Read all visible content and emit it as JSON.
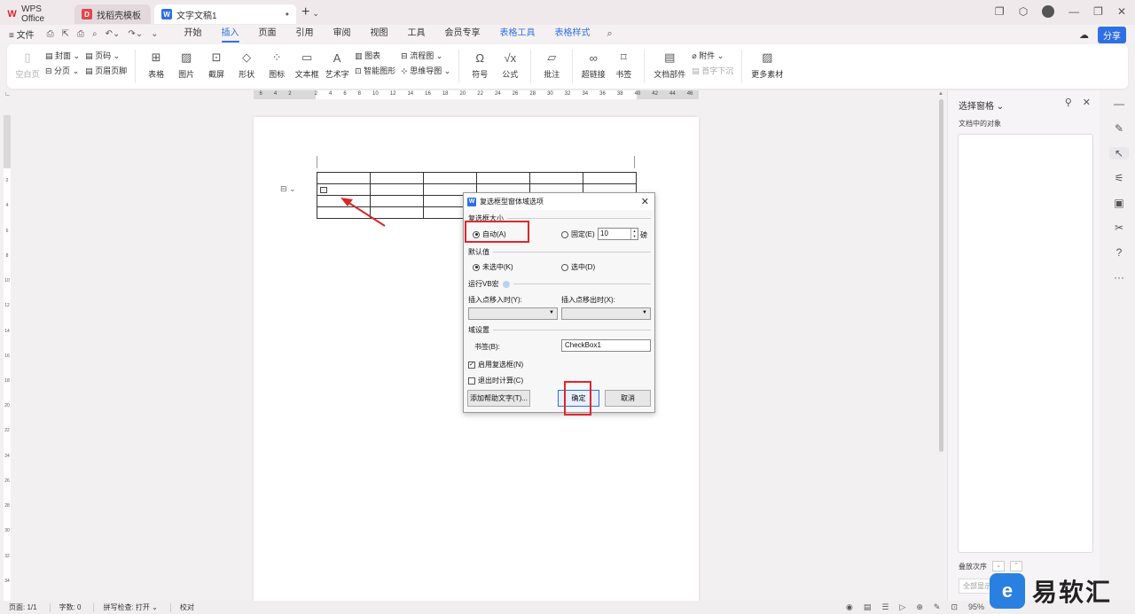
{
  "tabs": [
    {
      "label": "WPS Office"
    },
    {
      "label": "找稻壳模板"
    },
    {
      "label": "文字文稿1"
    }
  ],
  "menu": {
    "file": "≡ 文件",
    "items": [
      "开始",
      "插入",
      "页面",
      "引用",
      "审阅",
      "视图",
      "工具",
      "会员专享",
      "表格工具",
      "表格样式"
    ],
    "active": "插入",
    "share": "分享"
  },
  "ribbon": {
    "blank_page": "空白页",
    "cover": "封面",
    "page_break": "分页",
    "page_number": "页码",
    "header_footer": "页眉页脚",
    "table": "表格",
    "picture": "图片",
    "screenshot": "截屏",
    "shape": "形状",
    "icon": "图标",
    "textbox": "文本框",
    "art_text": "艺术字",
    "chart": "图表",
    "smart_shape": "智能图形",
    "flowchart": "流程图",
    "mindmap": "思维导图",
    "symbol": "符号",
    "formula": "公式",
    "comment": "批注",
    "hyperlink": "超链接",
    "bookmark": "书签",
    "doc_parts": "文档部件",
    "attachment": "附件",
    "drop_cap": "首字下沉",
    "more": "更多素材"
  },
  "ruler": {
    "h_ticks": [
      "6",
      "4",
      "2",
      "",
      "2",
      "4",
      "6",
      "8",
      "10",
      "12",
      "14",
      "16",
      "18",
      "20",
      "22",
      "24",
      "26",
      "28",
      "30",
      "32",
      "34",
      "36",
      "38",
      "40",
      "42",
      "44",
      "46"
    ],
    "v_ticks": [
      "2",
      "4",
      "6",
      "8",
      "10",
      "12",
      "14",
      "16",
      "18",
      "20",
      "22",
      "24",
      "26",
      "28",
      "30",
      "32",
      "34"
    ]
  },
  "dialog": {
    "title": "复选框型窗体域选项",
    "size_section": "复选框大小",
    "auto": "自动(A)",
    "fixed": "固定(E)",
    "size_value": "10",
    "unit": "磅",
    "default_section": "默认值",
    "unchecked": "未选中(K)",
    "checked": "选中(D)",
    "macro_section": "运行VB宏",
    "on_entry": "插入点移入时(Y):",
    "on_exit": "插入点移出时(X):",
    "field_section": "域设置",
    "bookmark_label": "书签(B):",
    "bookmark_value": "CheckBox1",
    "enable": "启用复选框(N)",
    "calc_on_exit": "退出时计算(C)",
    "help_text_btn": "添加帮助文字(T)...",
    "ok": "确定",
    "cancel": "取消"
  },
  "panel": {
    "title": "选择窗格",
    "objects_label": "文档中的对象",
    "order_label": "叠放次序",
    "show_all": "全部显示"
  },
  "status": {
    "page": "页面: 1/1",
    "words": "字数: 0",
    "spell": "拼写检查: 打开",
    "proof": "校对",
    "zoom": "95%"
  },
  "watermark": {
    "logo": "e",
    "text": "易软汇"
  },
  "colors": {
    "accent": "#2f6fe4",
    "highlight": "#e0262b"
  }
}
